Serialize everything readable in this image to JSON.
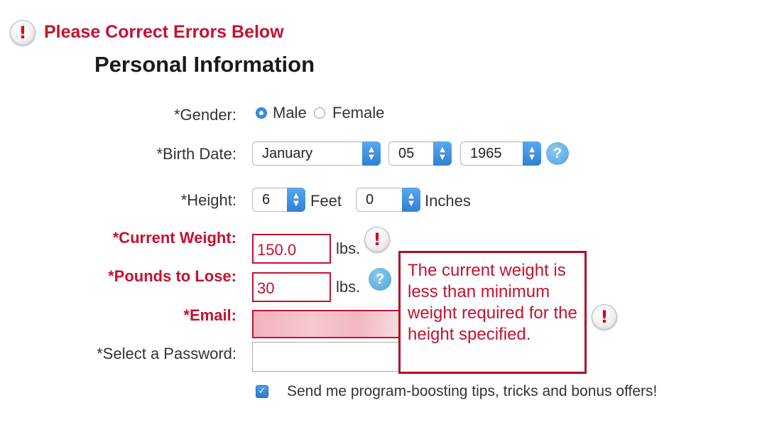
{
  "header": {
    "error_icon": "exclamation-icon",
    "error_text": "Please Correct Errors Below",
    "section_title": "Personal Information"
  },
  "form": {
    "gender": {
      "label": "*Gender:",
      "options": [
        {
          "label": "Male",
          "selected": true
        },
        {
          "label": "Female",
          "selected": false
        }
      ]
    },
    "birth_date": {
      "label": "*Birth Date:",
      "month": "January",
      "day": "05",
      "year": "1965",
      "help_icon": "question-icon",
      "help_glyph": "?"
    },
    "height": {
      "label": "*Height:",
      "feet": "6",
      "feet_unit": "Feet",
      "inches": "0",
      "inches_unit": "Inches"
    },
    "current_weight": {
      "label": "*Current Weight:",
      "value": "150.0",
      "unit": "lbs.",
      "has_error": true
    },
    "pounds_to_lose": {
      "label": "*Pounds to Lose:",
      "value": "30",
      "unit": "lbs.",
      "help_glyph": "?"
    },
    "email": {
      "label": "*Email:",
      "value": "",
      "has_error": true
    },
    "password": {
      "label": "*Select a Password:",
      "value": ""
    },
    "newsletter": {
      "checked": true,
      "label": "Send me program-boosting tips, tricks and bonus offers!"
    }
  },
  "tooltip": {
    "text": "The current weight is less than minimum weight required for the height specified."
  },
  "colors": {
    "error_red": "#c4122f",
    "accent_blue": "#3b8fe0",
    "help_blue": "#4ea3da"
  }
}
